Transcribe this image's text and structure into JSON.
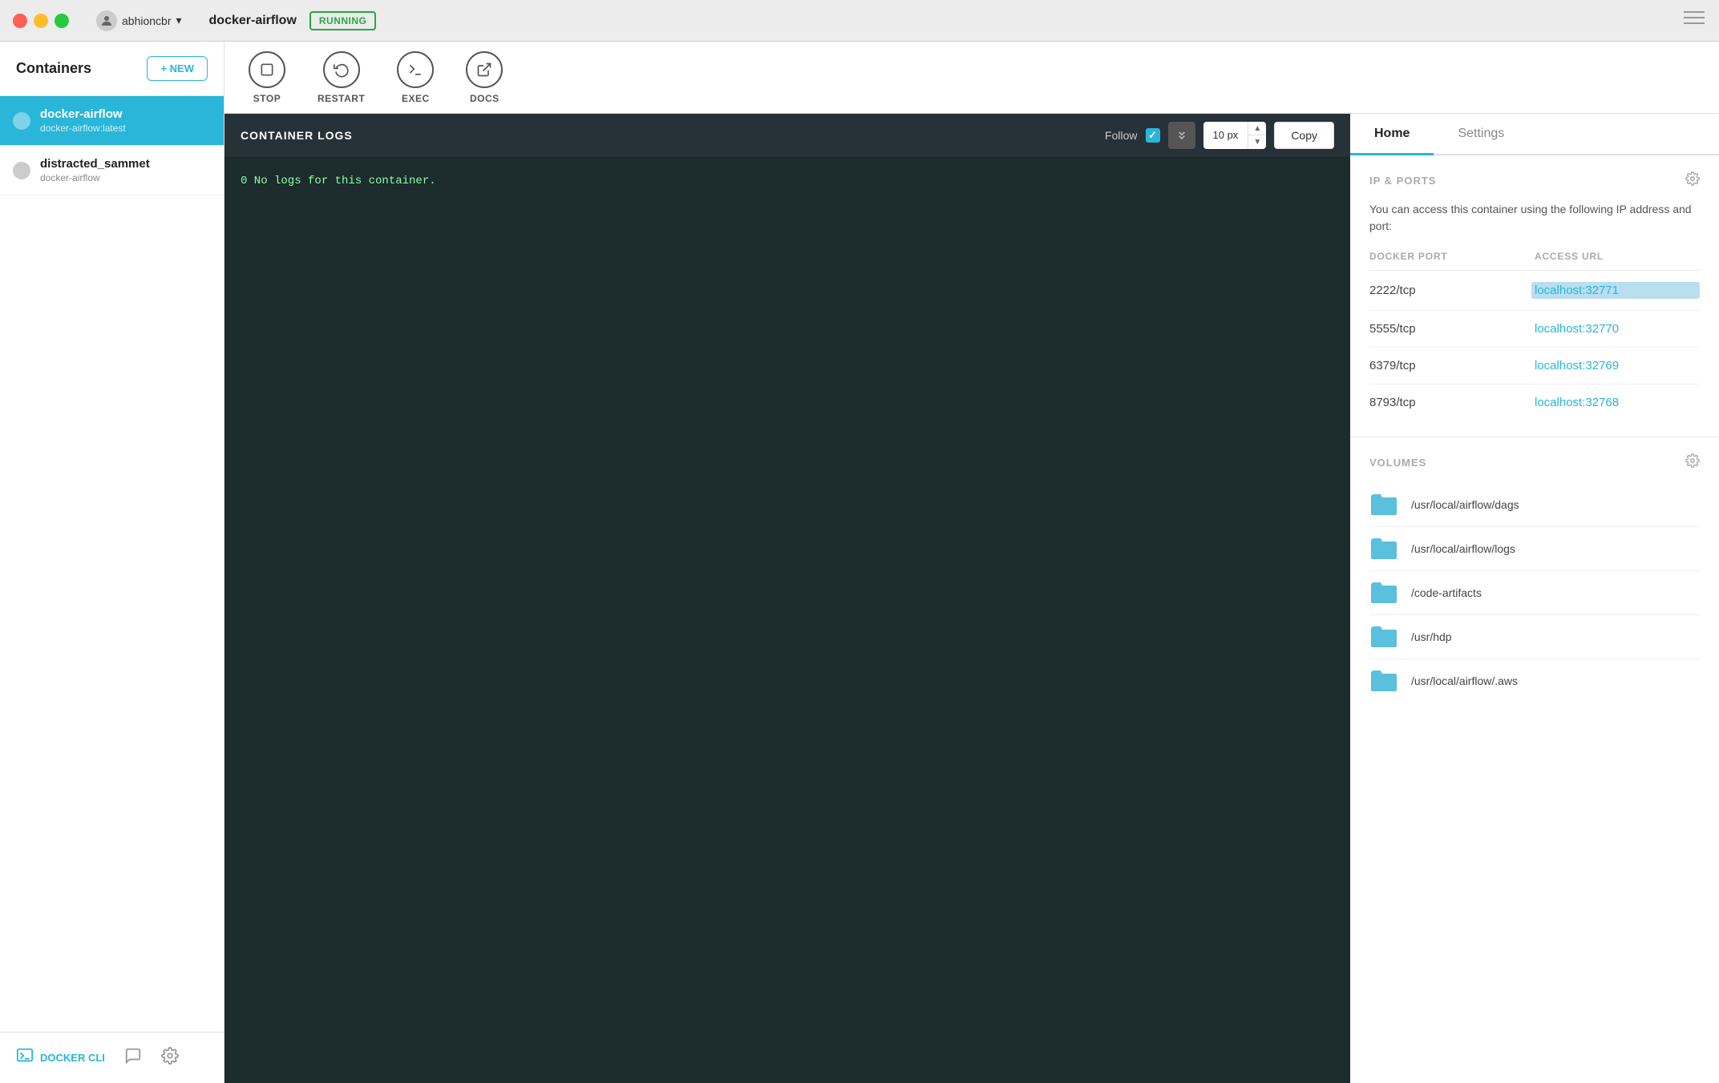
{
  "titlebar": {
    "user": "abhioncbr",
    "container_name": "docker-airflow",
    "status": "RUNNING"
  },
  "sidebar": {
    "title": "Containers",
    "new_button": "+ NEW",
    "items": [
      {
        "name": "docker-airflow",
        "image": "docker-airflow:latest",
        "active": true
      },
      {
        "name": "distracted_sammet",
        "image": "docker-airflow",
        "active": false
      }
    ],
    "footer": {
      "cli_label": "DOCKER CLI",
      "chat_icon": "💬",
      "gear_icon": "⚙"
    }
  },
  "toolbar": {
    "stop_label": "STOP",
    "restart_label": "RESTART",
    "exec_label": "EXEC",
    "docs_label": "DOCS"
  },
  "tabs": {
    "home": "Home",
    "settings": "Settings"
  },
  "logs": {
    "title": "CONTAINER LOGS",
    "follow_label": "Follow",
    "px_value": "10 px",
    "copy_label": "Copy",
    "content": "0 No logs for this container."
  },
  "ip_ports": {
    "title": "IP & PORTS",
    "description": "You can access this container using the following IP address and port:",
    "docker_port_label": "DOCKER PORT",
    "access_url_label": "ACCESS URL",
    "ports": [
      {
        "docker": "2222/tcp",
        "url": "localhost:32771",
        "selected": true
      },
      {
        "docker": "5555/tcp",
        "url": "localhost:32770",
        "selected": false
      },
      {
        "docker": "6379/tcp",
        "url": "localhost:32769",
        "selected": false
      },
      {
        "docker": "8793/tcp",
        "url": "localhost:32768",
        "selected": false
      }
    ]
  },
  "volumes": {
    "title": "VOLUMES",
    "items": [
      "/usr/local/airflow/dags",
      "/usr/local/airflow/logs",
      "/code-artifacts",
      "/usr/hdp",
      "/usr/local/airflow/.aws"
    ]
  }
}
